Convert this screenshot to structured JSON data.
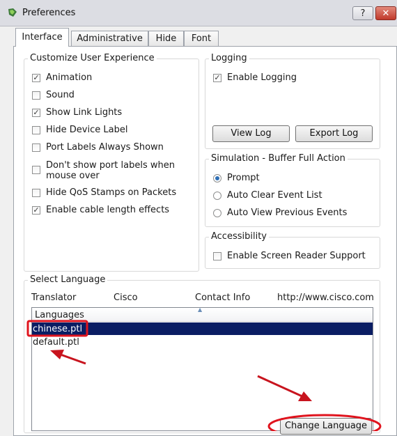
{
  "window": {
    "title": "Preferences",
    "help_label": "?",
    "close_label": "✕"
  },
  "tabs": [
    {
      "label": "Interface"
    },
    {
      "label": "Administrative"
    },
    {
      "label": "Hide"
    },
    {
      "label": "Font"
    }
  ],
  "customize": {
    "title": "Customize User Experience",
    "items": [
      {
        "label": "Animation",
        "checked": true
      },
      {
        "label": "Sound",
        "checked": false
      },
      {
        "label": "Show Link Lights",
        "checked": true
      },
      {
        "label": "Hide Device Label",
        "checked": false
      },
      {
        "label": "Port Labels Always Shown",
        "checked": false
      },
      {
        "label": "Don't show port labels when mouse over",
        "checked": false
      },
      {
        "label": "Hide QoS Stamps on Packets",
        "checked": false
      },
      {
        "label": "Enable cable length effects",
        "checked": true
      }
    ]
  },
  "logging": {
    "title": "Logging",
    "enable_label": "Enable Logging",
    "enable_checked": true,
    "view_log": "View Log",
    "export_log": "Export Log"
  },
  "simulation": {
    "title": "Simulation - Buffer Full Action",
    "options": [
      {
        "label": "Prompt",
        "selected": true
      },
      {
        "label": "Auto Clear Event List",
        "selected": false
      },
      {
        "label": "Auto View Previous Events",
        "selected": false
      }
    ]
  },
  "accessibility": {
    "title": "Accessibility",
    "screen_reader_label": "Enable Screen Reader Support",
    "screen_reader_checked": false
  },
  "language": {
    "title": "Select Language",
    "translator_label": "Translator",
    "translator_value": "Cisco",
    "contact_label": "Contact Info",
    "contact_value": "http://www.cisco.com",
    "column_header": "Languages",
    "items": [
      "chinese.ptl",
      "default.ptl"
    ],
    "selected_index": 0,
    "change_button": "Change Language"
  },
  "colors": {
    "selection": "#0a1d63",
    "annotation_red": "#e0141e",
    "check_mark": "#3c3c3c"
  }
}
